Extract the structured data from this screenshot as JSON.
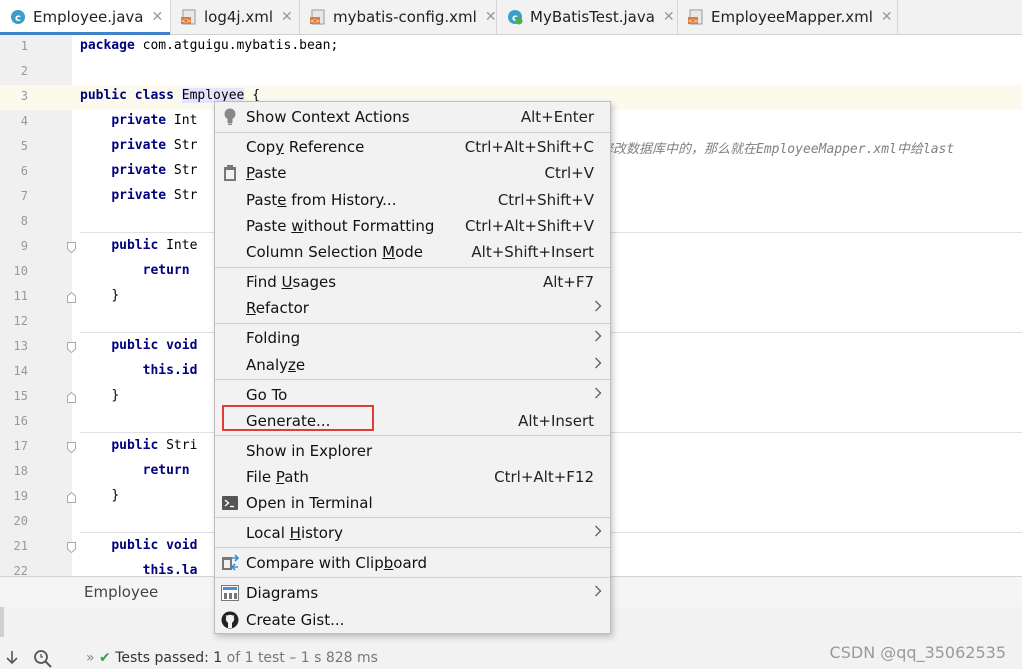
{
  "tabs": [
    {
      "label": "Employee.java",
      "icon": "java-class-icon",
      "active": true
    },
    {
      "label": "log4j.xml",
      "icon": "xml-file-icon"
    },
    {
      "label": "mybatis-config.xml",
      "icon": "xml-file-icon"
    },
    {
      "label": "MyBatisTest.java",
      "icon": "java-test-class-icon"
    },
    {
      "label": "EmployeeMapper.xml",
      "icon": "xml-file-icon"
    }
  ],
  "editor": {
    "line_numbers": [
      "1",
      "2",
      "3",
      "4",
      "5",
      "6",
      "7",
      "8",
      "9",
      "10",
      "11",
      "12",
      "13",
      "14",
      "15",
      "16",
      "17",
      "18",
      "19",
      "20",
      "21",
      "22"
    ],
    "line1": {
      "kw": "package",
      "rest": " com.atguigu.mybatis.bean;"
    },
    "line3": {
      "kw": "public class",
      "name": "Employee",
      "rest": " {"
    },
    "line4": {
      "kw": "private",
      "rest": " Int"
    },
    "line5": {
      "kw": "private",
      "rest": " Str",
      "comment": "修改数据库中的，那么就在EmployeeMapper.xml中给last"
    },
    "line6": {
      "kw": "private",
      "rest": " Str"
    },
    "line7": {
      "kw": "private",
      "rest": " Str"
    },
    "line9": {
      "kw": "public",
      "rest": " Inte"
    },
    "line10": {
      "kw": "return",
      "rest": ""
    },
    "line11": {
      "rest": "}"
    },
    "line13": {
      "kw": "public void",
      "rest": ""
    },
    "line14": {
      "kw": "this",
      "rest": ".id"
    },
    "line15": {
      "rest": "}"
    },
    "line17": {
      "kw": "public",
      "rest": " Stri"
    },
    "line18": {
      "kw": "return",
      "rest": ""
    },
    "line19": {
      "rest": "}"
    },
    "line21": {
      "kw": "public void",
      "rest": ""
    },
    "line22": {
      "kw": "this",
      "rest": ".la"
    }
  },
  "breadcrumb": "Employee",
  "context_menu": {
    "items": [
      {
        "pre": "Show Context Actions",
        "u": "",
        "post": "",
        "shortcut": "Alt+Enter",
        "icon": "lightbulb-icon"
      },
      {
        "pre": "Cop",
        "u": "y",
        "post": " Reference",
        "shortcut": "Ctrl+Alt+Shift+C"
      },
      {
        "pre": "",
        "u": "P",
        "post": "aste",
        "shortcut": "Ctrl+V",
        "icon": "clipboard-icon"
      },
      {
        "pre": "Past",
        "u": "e",
        "post": " from History...",
        "shortcut": "Ctrl+Shift+V"
      },
      {
        "pre": "Paste ",
        "u": "w",
        "post": "ithout Formatting",
        "shortcut": "Ctrl+Alt+Shift+V"
      },
      {
        "pre": "Column Selection ",
        "u": "M",
        "post": "ode",
        "shortcut": "Alt+Shift+Insert"
      },
      {
        "pre": "Find ",
        "u": "U",
        "post": "sages",
        "shortcut": "Alt+F7"
      },
      {
        "pre": "",
        "u": "R",
        "post": "efactor",
        "shortcut": "",
        "submenu": true
      },
      {
        "pre": "Folding",
        "u": "",
        "post": "",
        "shortcut": "",
        "submenu": true
      },
      {
        "pre": "Analy",
        "u": "z",
        "post": "e",
        "shortcut": "",
        "submenu": true
      },
      {
        "pre": "Go To",
        "u": "",
        "post": "",
        "shortcut": "",
        "submenu": true
      },
      {
        "pre": "Generate...",
        "u": "",
        "post": "",
        "shortcut": "Alt+Insert"
      },
      {
        "pre": "Show in Explorer",
        "u": "",
        "post": "",
        "shortcut": ""
      },
      {
        "pre": "File ",
        "u": "P",
        "post": "ath",
        "shortcut": "Ctrl+Alt+F12"
      },
      {
        "pre": "Open in Terminal",
        "u": "",
        "post": "",
        "shortcut": "",
        "icon": "terminal-icon"
      },
      {
        "pre": "Local ",
        "u": "H",
        "post": "istory",
        "shortcut": "",
        "submenu": true
      },
      {
        "pre": "Compare with Clip",
        "u": "b",
        "post": "oard",
        "shortcut": "",
        "icon": "compare-icon"
      },
      {
        "pre": "Diagrams",
        "u": "",
        "post": "",
        "shortcut": "",
        "submenu": true,
        "icon": "diagram-icon"
      },
      {
        "pre": "Create Gist...",
        "u": "",
        "post": "",
        "shortcut": "",
        "icon": "github-icon"
      }
    ]
  },
  "status_bar": {
    "label": "Tests passed:",
    "count": "1",
    "detail": "of 1 test – 1 s 828 ms"
  },
  "watermark": "CSDN @qq_35062535",
  "colors": {
    "accent": "#4083c9",
    "highlight_box": "#e03b3b",
    "keyword": "#000080",
    "pass": "#4caf50"
  }
}
